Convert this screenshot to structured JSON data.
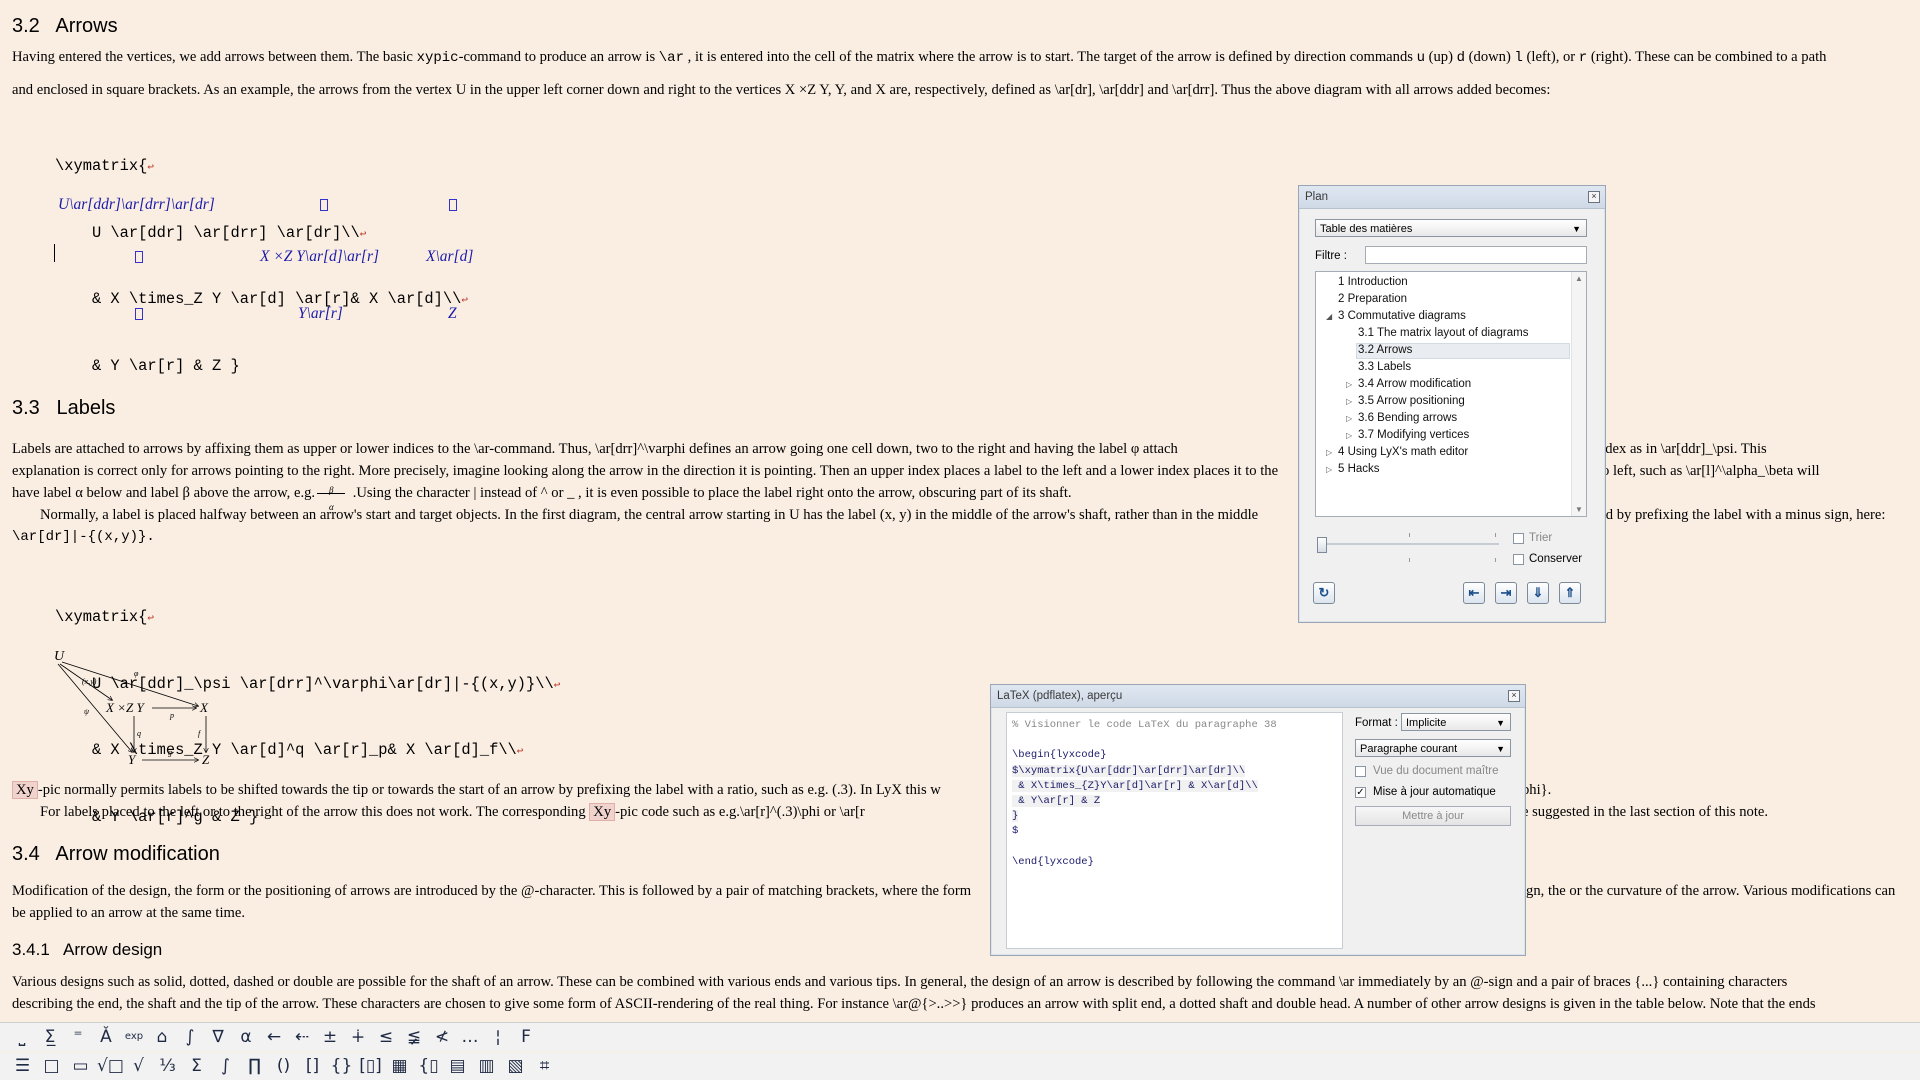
{
  "doc": {
    "s32_title": "3.2   Arrows",
    "s32_p1_a": "Having entered the vertices, we add arrows between them. The basic ",
    "s32_p1_code1": "xypic",
    "s32_p1_b": "-command to produce an arrow is ",
    "s32_p1_code2": "\\ar",
    "s32_p1_c": " , it is entered into the cell of the matrix where the arrow is to start. The target of the arrow is defined by direction commands ",
    "s32_p1_u": "u",
    "s32_p1_d1": " (up) ",
    "s32_p1_dcode": "d",
    "s32_p1_d2": " (down) ",
    "s32_p1_lcode": "l",
    "s32_p1_d3": " (left), or ",
    "s32_p1_rcode": "r",
    "s32_p1_d4": " (right). These can be combined to a path",
    "s32_p2": "and enclosed in square brackets. As an example, the arrows from the vertex U in the upper left corner down and right to the vertices X ×Z Y, Y, and X are, respectively, defined as \\ar[dr], \\ar[ddr] and \\ar[drr]. Thus the above diagram with all arrows added becomes:",
    "code1": [
      "\\xymatrix{",
      "    U \\ar[ddr] \\ar[drr] \\ar[dr]\\\\",
      "    & X \\times_Z Y \\ar[d] \\ar[r]& X \\ar[d]\\\\",
      "    & Y \\ar[r] & Z }"
    ],
    "return_glyph": "↩",
    "diag1": {
      "r1": "U\\ar[ddr]\\ar[drr]\\ar[dr]",
      "r2a": "X ×Z Y\\ar[d]\\ar[r]",
      "r2b": "X\\ar[d]",
      "r3a": "Y\\ar[r]",
      "r3b": "Z"
    },
    "s33_title": "3.3   Labels",
    "s33_l1": "Labels are attached to arrows by affixing them as upper or lower indices to the \\ar-command. Thus, \\ar[drr]^\\varphi defines an arrow going one cell down, two to the right and having the label φ  attach",
    "s33_l1_right": "e it a lower index as in \\ar[ddr]_\\psi. This",
    "s33_l2": "explanation is correct only for arrows pointing to the right. More precisely, imagine looking along the arrow in the direction it is pointing. Then an upper index places a label to the left and a lower index places it to the",
    "s33_l2_right": "o left, such as \\ar[l]^\\alpha_\\beta will",
    "s33_l3": "have label α  below and label β above the arrow, e.g.",
    "s33_l3_b": " .Using the character | instead of ^ or _ , it is even possible to place the label right onto the arrow, obscuring part of its shaft.",
    "s33_l4": "Normally, a label is placed halfway between an arrow's start and target objects. In the first diagram, the central arrow starting in U has the label (x, y) in the middle of the arrow's shaft, rather than in the middle",
    "s33_l4_right": "ved by prefixing the label with a minus sign, here:",
    "s33_l5": "\\ar[dr]|-{(x,y)}.",
    "code2": [
      "\\xymatrix{",
      "    U \\ar[ddr]_\\psi \\ar[drr]^\\varphi\\ar[dr]|-{(x,y)}\\\\",
      "    & X \\times_Z Y \\ar[d]^q \\ar[r]_p& X \\ar[d]_f\\\\",
      "    & Y \\ar[r]^g & Z }"
    ],
    "s33_l6_xy": "Xy",
    "s33_l6": "-pic normally permits labels to be shifted towards the tip or towards the start of an arrow by prefixing the label with a ratio, such as e.g. (.3). In LyX this w",
    "s33_l6_right": "phi}.",
    "s33_l7": "For labels placed to the left or to the right of the arrow this does not work. The corresponding ",
    "s33_l7_xy": "Xy",
    "s33_l7_b": "-pic code such as e.g.\\ar[r]^(.3)\\phi or \\ar[r",
    "s33_l7_right": "e suggested in the last section of this note.",
    "s34_title": "3.4   Arrow modification",
    "s34_l1": "Modification of the design, the form or the positioning of arrows are introduced by the @-character. This is followed by a pair of matching brackets, where the form",
    "s34_l1_right": "ign, the or the curvature of the arrow. Various modifications can",
    "s34_l2": "be applied to an arrow at the same time.",
    "s341_title": "3.4.1   Arrow design",
    "s341_l1": "Various designs such as solid, dotted, dashed or double are possible for the shaft of an arrow. These can be combined with various ends and various tips. In general, the design of an arrow is described by following the command \\ar immediately by an @-sign and a pair of braces {...} containing characters",
    "s341_l2": "describing the end, the shaft and the tip of the arrow. These characters are chosen to give some form of ASCII-rendering of the real thing. For instance \\ar@{>..>>} produces an arrow with split end, a dotted shaft and double head. A number of other arrow designs is given in the table below. Note that the ends",
    "diag2": {
      "U": "U",
      "X1": "X ×Z Y",
      "X2": "X",
      "Y": "Y",
      "Z": "Z",
      "xy": "(x,y)",
      "phi": "φ",
      "psi": "ψ",
      "p": "p",
      "q": "q",
      "f": "f",
      "g": "g"
    },
    "label_example_top": "β",
    "label_example_bot": "α"
  },
  "plan": {
    "title": "Plan",
    "combo": "Table des matières",
    "filter_label": "Filtre :",
    "items": [
      {
        "label": "1 Introduction",
        "level": 0,
        "expander": ""
      },
      {
        "label": "2 Preparation",
        "level": 0,
        "expander": ""
      },
      {
        "label": "3 Commutative diagrams",
        "level": 0,
        "expander": "◢"
      },
      {
        "label": "3.1 The matrix layout of diagrams",
        "level": 1,
        "expander": ""
      },
      {
        "label": "3.2 Arrows",
        "level": 1,
        "expander": "",
        "selected": true
      },
      {
        "label": "3.3 Labels",
        "level": 1,
        "expander": ""
      },
      {
        "label": "3.4 Arrow modification",
        "level": 1,
        "expander": "▷"
      },
      {
        "label": "3.5 Arrow positioning",
        "level": 1,
        "expander": "▷"
      },
      {
        "label": "3.6 Bending arrows",
        "level": 1,
        "expander": "▷"
      },
      {
        "label": "3.7 Modifying vertices",
        "level": 1,
        "expander": "▷"
      },
      {
        "label": "4 Using LyX's math editor",
        "level": 0,
        "expander": "▷"
      },
      {
        "label": "5 Hacks",
        "level": 0,
        "expander": "▷"
      }
    ],
    "sort_label": "Trier",
    "keep_label": "Conserver",
    "sort_checked": false,
    "keep_checked": false
  },
  "preview": {
    "title": "LaTeX (pdflatex), aperçu",
    "code_lines": [
      "% Visionner le code LaTeX du paragraphe 38",
      "",
      "\\begin{lyxcode}",
      "$\\xymatrix{U\\ar[ddr]\\ar[drr]\\ar[dr]\\\\",
      " & X\\times_{Z}Y\\ar[d]\\ar[r] & X\\ar[d]\\\\",
      " & Y\\ar[r] & Z",
      "}",
      "$",
      "",
      "\\end{lyxcode}"
    ],
    "format_label": "Format :",
    "format_value": "Implicite",
    "paragraph_value": "Paragraphe courant",
    "master_label": "Vue du document maître",
    "auto_label": "Mise à jour automatique",
    "update_button": "Mettre à jour",
    "master_checked": false,
    "auto_checked": true
  },
  "toolbar1": [
    "⎵",
    "Σ̲",
    "⁼",
    "Ǎ",
    "exp",
    "⌂",
    "∫",
    "∇",
    "α",
    "←",
    "⇠",
    "±",
    "∔",
    "≤",
    "≨",
    "≮",
    "…",
    "¦",
    "F"
  ],
  "toolbar2": [
    "☰",
    "□",
    "▭",
    "√□",
    "√",
    "⅓",
    "Σ",
    "∫",
    "∏",
    "()",
    "[]",
    "{}",
    "[▯]",
    "▦",
    "{▯",
    "▤",
    "▥",
    "▧",
    "⌗"
  ],
  "colors": {
    "page": "#faeee3",
    "accent": "#1a1aa8",
    "return": "#c0392b"
  }
}
